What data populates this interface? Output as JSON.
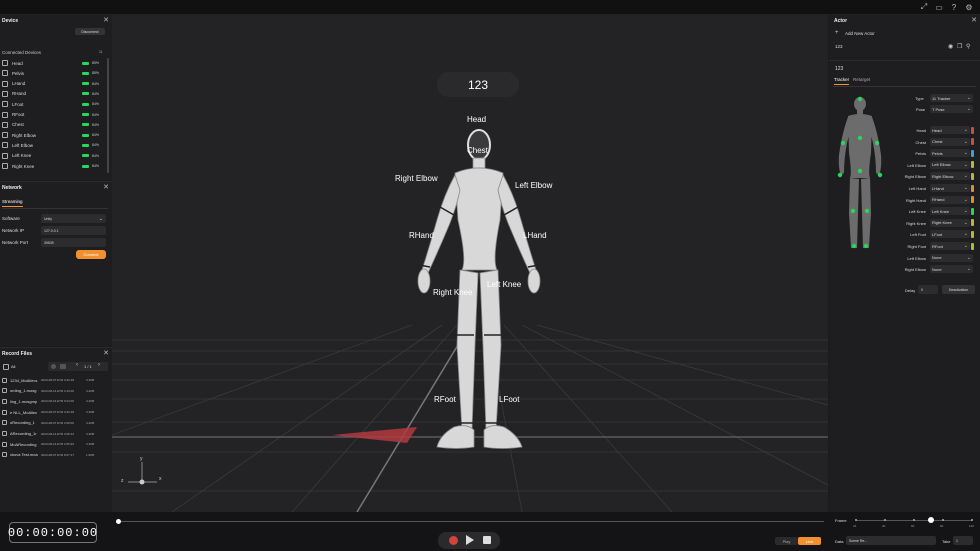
{
  "device": {
    "title": "Device",
    "disconnect_label": "Disconnect",
    "connected_title": "Connected Devices",
    "connected_count": "11",
    "devices": [
      {
        "name": "Head",
        "battery": "85%"
      },
      {
        "name": "Pelvis",
        "battery": "85%"
      },
      {
        "name": "LHand",
        "battery": "84%"
      },
      {
        "name": "RHand",
        "battery": "84%"
      },
      {
        "name": "LFoot",
        "battery": "84%"
      },
      {
        "name": "RFoot",
        "battery": "84%"
      },
      {
        "name": "Chest",
        "battery": "84%"
      },
      {
        "name": "Right Elbow",
        "battery": "84%"
      },
      {
        "name": "Left Elbow",
        "battery": "84%"
      },
      {
        "name": "Left Knee",
        "battery": "84%"
      },
      {
        "name": "Right Knee",
        "battery": "84%"
      }
    ]
  },
  "network": {
    "title": "Network",
    "tab": "Streaming",
    "software_label": "Software",
    "software_value": "Unity",
    "ip_label": "Network IP",
    "ip_value": "127.0.0.1",
    "port_label": "Network Port",
    "port_value": "39539",
    "connect_label": "Connect"
  },
  "record": {
    "title": "Record Files",
    "all_label": "All",
    "page": "1 / 1",
    "files": [
      {
        "name": "1234_MoAllecs",
        "date": "2023-08-07 ETR 3:22:18",
        "size": "4.4KB"
      },
      {
        "name": "ording_1.mosg",
        "date": "2023-08-14 ETR 3:16:00",
        "size": "4.4KB"
      },
      {
        "name": "ling_1.mosgmp",
        "date": "2023-08-16 ETR 6:04:00",
        "size": "4.4KB"
      },
      {
        "name": "e NLL_MoAllec",
        "date": "2023-08-07 ETR 3:22:18",
        "size": "4.4KB"
      },
      {
        "name": "oRecording_1",
        "date": "2023-08-07 ETR 2:08:00",
        "size": "4.4KB"
      },
      {
        "name": "ARecording_1r",
        "date": "2023-08-14 ETR 3:08:12",
        "size": "4.4KB"
      },
      {
        "name": "MoARecording",
        "date": "2023-08-14 ETR 2:05:40",
        "size": "4.4KB"
      },
      {
        "name": "xkova Test.moa",
        "date": "2023-08-07 ETR 8:07:17",
        "size": "1.6KB"
      }
    ]
  },
  "viewport": {
    "actor_name": "123",
    "labels": [
      {
        "text": "Head"
      },
      {
        "text": "Chest"
      },
      {
        "text": "Right Elbow"
      },
      {
        "text": "Left Elbow"
      },
      {
        "text": "RHand"
      },
      {
        "text": "LHand"
      },
      {
        "text": "Right Knee"
      },
      {
        "text": "Left Knee"
      },
      {
        "text": "RFoot"
      },
      {
        "text": "LFoot"
      }
    ],
    "axis_x": "x",
    "axis_y": "y",
    "axis_z": "z"
  },
  "actor": {
    "title": "Actor",
    "add_label": "Add New Actor",
    "actor_item": "123",
    "actor_tab_name": "123",
    "tab_tracker": "Tracker",
    "tab_retarget": "Retarget",
    "type_label": "Type",
    "type_value": "11 Tracker",
    "pose_label": "Pose",
    "pose_value": "T Pose",
    "bones": [
      {
        "label": "Head",
        "value": "Head",
        "color": "#c0504d"
      },
      {
        "label": "Chest",
        "value": "Chest",
        "color": "#c0504d"
      },
      {
        "label": "Pelvis",
        "value": "Pelvis",
        "color": "#3aa0d8"
      },
      {
        "label": "Left Elbow",
        "value": "Left Elbow",
        "color": "#b5b83b"
      },
      {
        "label": "Right Elbow",
        "value": "Right Elbow",
        "color": "#b5b83b"
      },
      {
        "label": "Left Hand",
        "value": "LHand",
        "color": "#d8923a"
      },
      {
        "label": "Right Hand",
        "value": "RHand",
        "color": "#d8923a"
      },
      {
        "label": "Left Knee",
        "value": "Left Knee",
        "color": "#2bd45a"
      },
      {
        "label": "Right Knee",
        "value": "Right Knee",
        "color": "#b5b83b"
      },
      {
        "label": "Left Foot",
        "value": "LFoot",
        "color": "#b5b83b"
      },
      {
        "label": "Right Foot",
        "value": "RFoot",
        "color": "#b5b83b"
      },
      {
        "label": "Left Elbow",
        "value": "None",
        "color": ""
      },
      {
        "label": "Right Elbow",
        "value": "None",
        "color": ""
      }
    ],
    "delay_label": "Delay",
    "delay_value": "0",
    "calibration_label": "Deactivation"
  },
  "bottom": {
    "timecode": "00:00:00:00",
    "play_label": "Play",
    "live_label": "Live",
    "frame_label": "Frame",
    "frame_ticks": [
      "24",
      "30",
      "60",
      "90",
      "120"
    ],
    "frame_value": 0.65,
    "data_label": "Data",
    "data_value": "Scene Re...",
    "take_label": "Take",
    "take_value": "1"
  }
}
